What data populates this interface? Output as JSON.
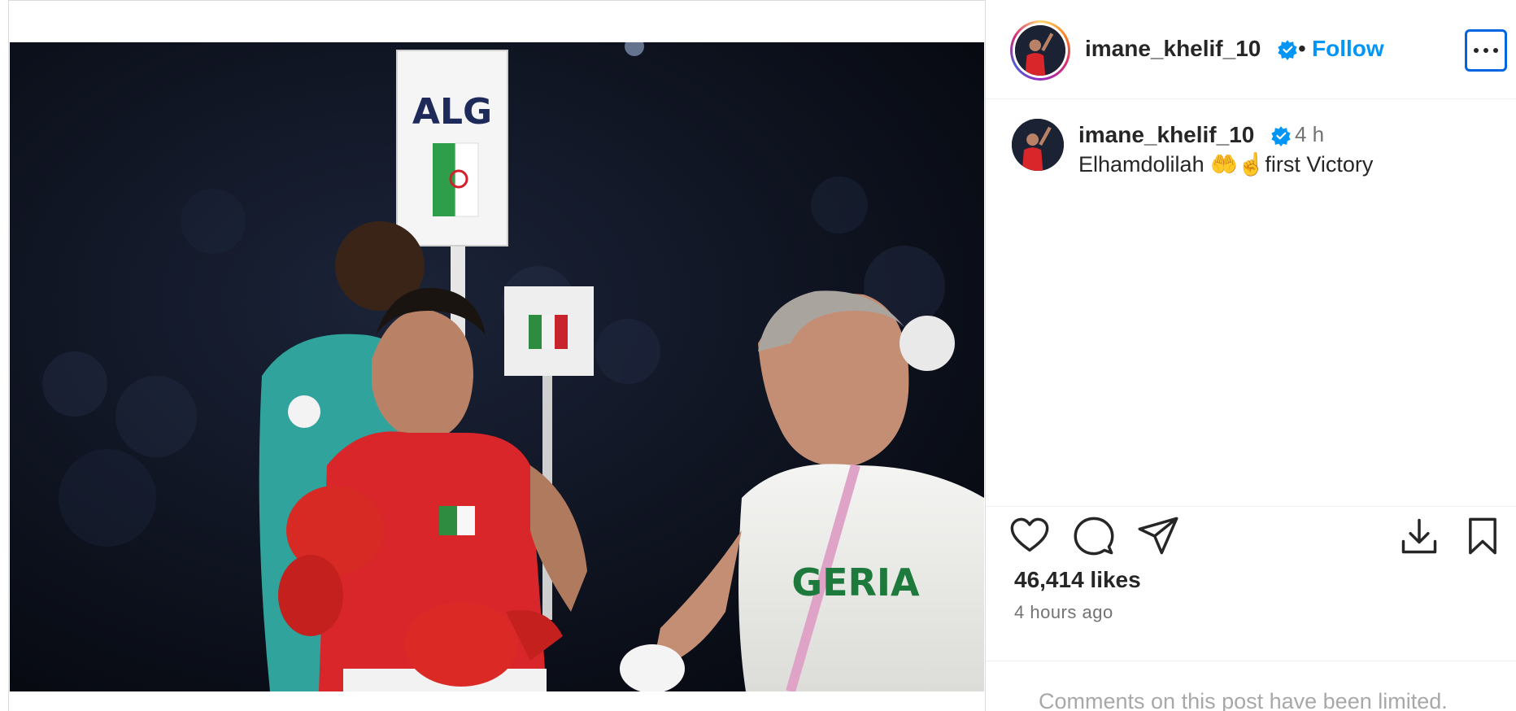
{
  "post": {
    "username": "imane_khelif_10",
    "follow_label": "Follow",
    "separator": "•",
    "media_alt": "Boxer in red with gloves walking beside coach, ALG sign",
    "sign_text": "ALG",
    "shirt_text": "GERIA"
  },
  "caption": {
    "username": "imane_khelif_10",
    "time": "4 h",
    "text": "Elhamdolilah 🤲☝️first Victory"
  },
  "stats": {
    "likes": "46,414 likes",
    "ago": "4 hours ago"
  },
  "comments": {
    "limited_text": "Comments on this post have been limited."
  },
  "icons": [
    "more-icon",
    "verified-icon",
    "heart-icon",
    "comment-icon",
    "share-icon",
    "download-icon",
    "bookmark-icon"
  ],
  "colors": {
    "link": "#0095f6",
    "verified": "#0095f6",
    "muted": "#737373"
  }
}
